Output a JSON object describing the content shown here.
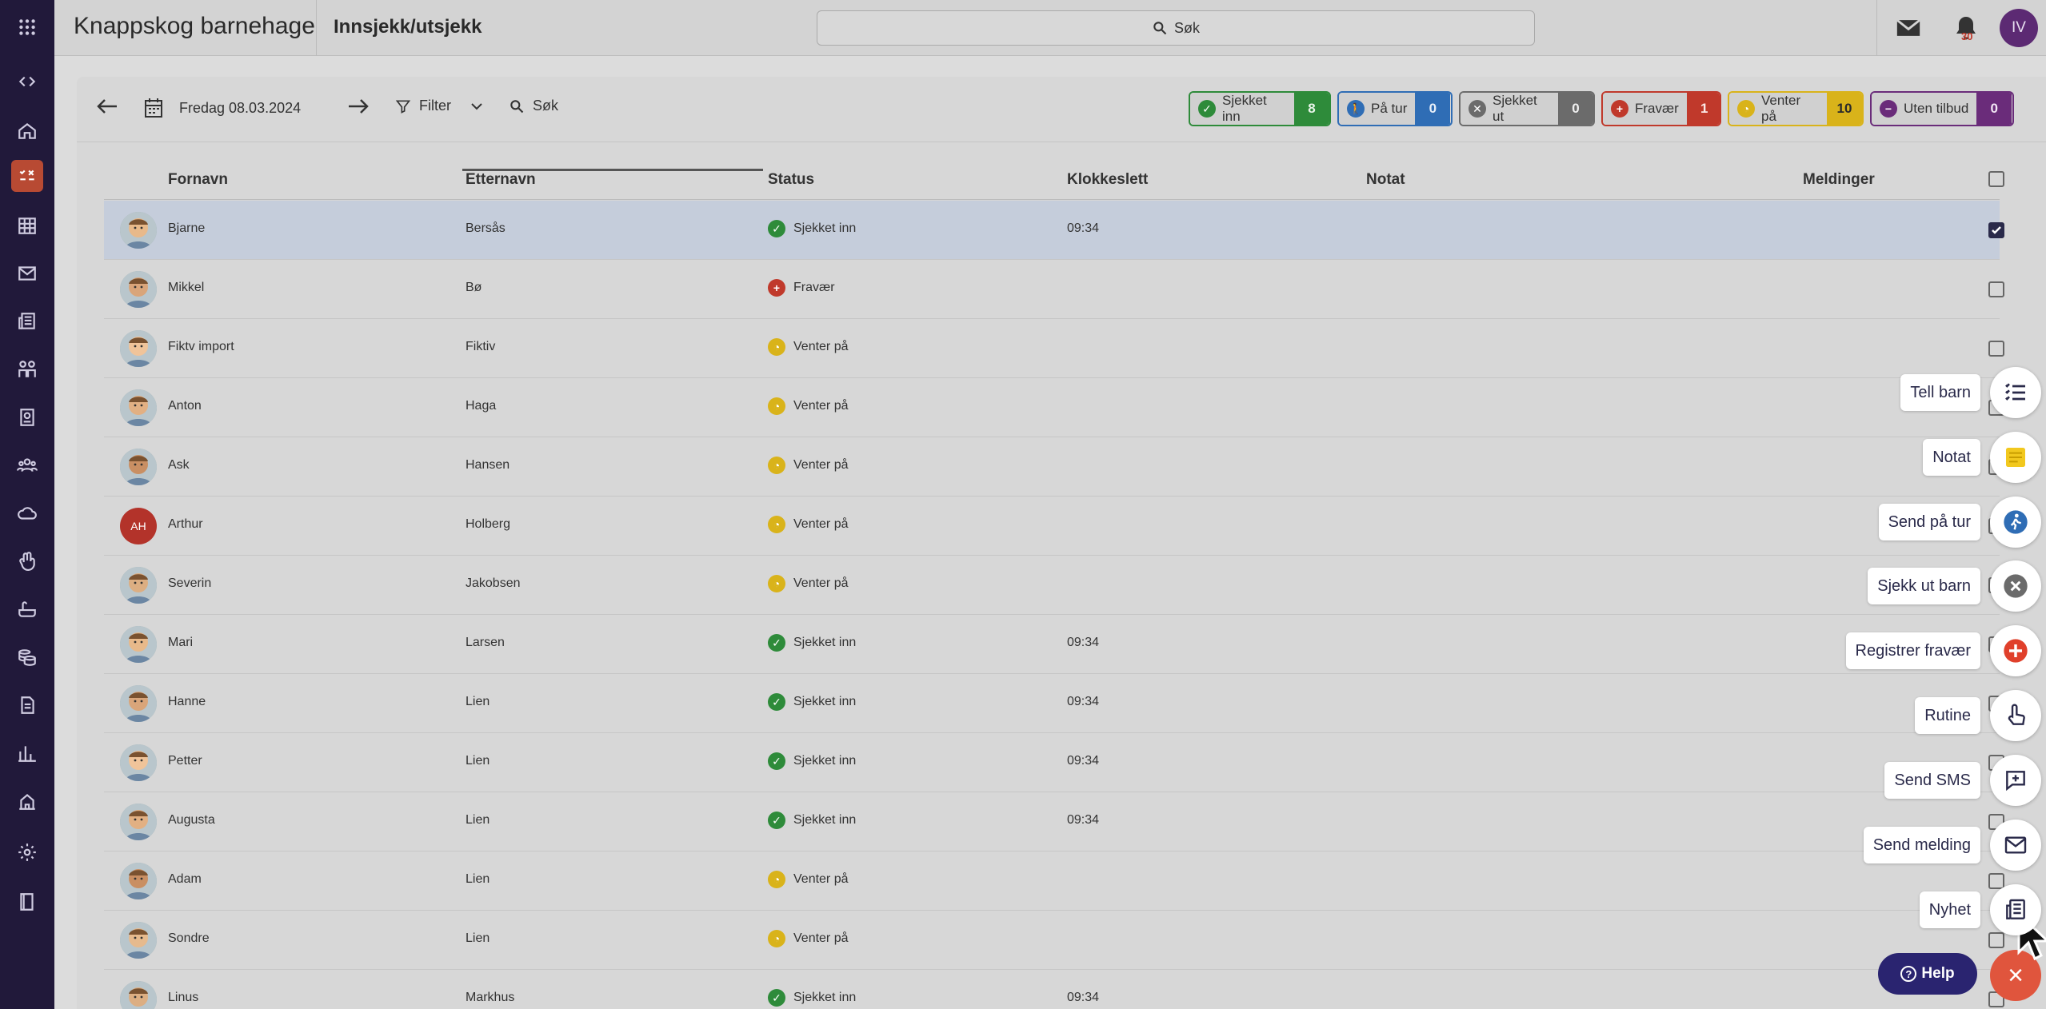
{
  "header": {
    "org_name": "Knappskog barnehage",
    "page_title": "Innsjekk/utsjekk",
    "search_label": "Søk",
    "notification_count": "30",
    "user_initials": "IV"
  },
  "toolbar": {
    "date": "Fredag 08.03.2024",
    "filter_label": "Filter",
    "search_label": "Søk"
  },
  "status_chips": [
    {
      "label": "Sjekket inn",
      "count": "8",
      "color": "#2e8b3a",
      "icon": "check-circle-icon"
    },
    {
      "label": "På tur",
      "count": "0",
      "color": "#2f6db5",
      "icon": "walking-icon"
    },
    {
      "label": "Sjekket ut",
      "count": "0",
      "color": "#6b6b6b",
      "icon": "x-circle-icon"
    },
    {
      "label": "Fravær",
      "count": "1",
      "color": "#c0392b",
      "icon": "plus-circle-icon"
    },
    {
      "label": "Venter på",
      "count": "10",
      "color": "#d9b31a",
      "icon": "clock-icon"
    },
    {
      "label": "Uten tilbud",
      "count": "0",
      "color": "#6a2c7a",
      "icon": "minus-circle-icon"
    }
  ],
  "table": {
    "columns": [
      "Fornavn",
      "Etternavn",
      "Status",
      "Klokkeslett",
      "Notat",
      "Meldinger"
    ],
    "rows": [
      {
        "first": "Bjarne",
        "last": "Bersås",
        "status": "Sjekket inn",
        "time": "09:34",
        "checked": true,
        "avatar": "photo"
      },
      {
        "first": "Mikkel",
        "last": "Bø",
        "status": "Fravær",
        "time": "",
        "checked": false,
        "avatar": "photo"
      },
      {
        "first": "Fiktv import",
        "last": "Fiktiv",
        "status": "Venter på",
        "time": "",
        "checked": false,
        "avatar": "photo"
      },
      {
        "first": "Anton",
        "last": "Haga",
        "status": "Venter på",
        "time": "",
        "checked": false,
        "avatar": "photo"
      },
      {
        "first": "Ask",
        "last": "Hansen",
        "status": "Venter på",
        "time": "",
        "checked": false,
        "avatar": "photo"
      },
      {
        "first": "Arthur",
        "last": "Holberg",
        "status": "Venter på",
        "time": "",
        "checked": false,
        "avatar": "AH"
      },
      {
        "first": "Severin",
        "last": "Jakobsen",
        "status": "Venter på",
        "time": "",
        "checked": false,
        "avatar": "photo"
      },
      {
        "first": "Mari",
        "last": "Larsen",
        "status": "Sjekket inn",
        "time": "09:34",
        "checked": false,
        "avatar": "photo"
      },
      {
        "first": "Hanne",
        "last": "Lien",
        "status": "Sjekket inn",
        "time": "09:34",
        "checked": false,
        "avatar": "photo"
      },
      {
        "first": "Petter",
        "last": "Lien",
        "status": "Sjekket inn",
        "time": "09:34",
        "checked": false,
        "avatar": "photo"
      },
      {
        "first": "Augusta",
        "last": "Lien",
        "status": "Sjekket inn",
        "time": "09:34",
        "checked": false,
        "avatar": "photo"
      },
      {
        "first": "Adam",
        "last": "Lien",
        "status": "Venter på",
        "time": "",
        "checked": false,
        "avatar": "photo"
      },
      {
        "first": "Sondre",
        "last": "Lien",
        "status": "Venter på",
        "time": "",
        "checked": false,
        "avatar": "photo"
      },
      {
        "first": "Linus",
        "last": "Markhus",
        "status": "Sjekket inn",
        "time": "09:34",
        "checked": false,
        "avatar": "photo"
      }
    ]
  },
  "fab_menu": [
    {
      "label": "Tell barn",
      "icon": "list-icon"
    },
    {
      "label": "Notat",
      "icon": "sticky-note-icon"
    },
    {
      "label": "Send på tur",
      "icon": "walking-icon"
    },
    {
      "label": "Sjekk ut barn",
      "icon": "x-circle-icon"
    },
    {
      "label": "Registrer fravær",
      "icon": "plus-circle-icon"
    },
    {
      "label": "Rutine",
      "icon": "hand-pointer-icon"
    },
    {
      "label": "Send SMS",
      "icon": "chat-plus-icon"
    },
    {
      "label": "Send melding",
      "icon": "envelope-icon"
    },
    {
      "label": "Nyhet",
      "icon": "newspaper-icon"
    }
  ],
  "help_label": "Help",
  "colors": {
    "rail": "#21193a",
    "active_rail": "#b84a33",
    "checked_in": "#2e8b3a",
    "absent": "#c0392b",
    "waiting": "#d9b31a",
    "fab_close": "#e0553d",
    "help": "#2a2470"
  }
}
